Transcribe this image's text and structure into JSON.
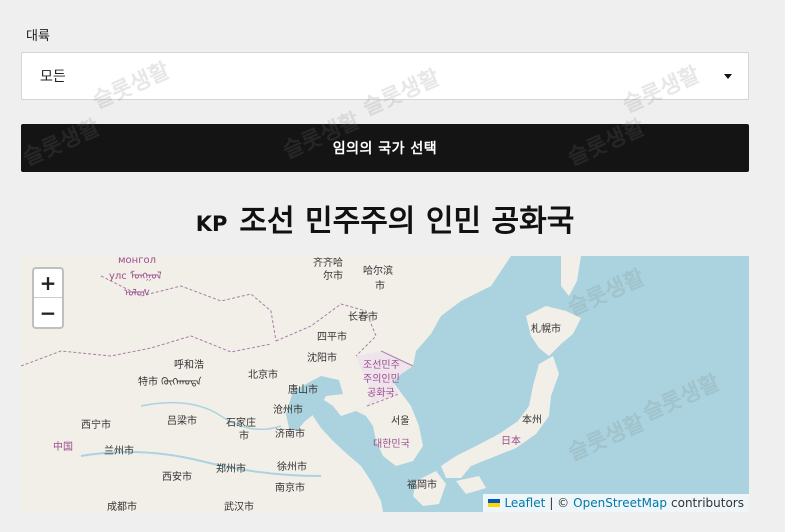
{
  "form": {
    "continent_label": "대륙",
    "continent_value": "모든",
    "random_button_label": "임의의 국가 선택"
  },
  "country": {
    "code": "KP",
    "name": "조선 민주주의 인민 공화국"
  },
  "map": {
    "zoom_in": "+",
    "zoom_out": "−",
    "attribution": {
      "leaflet": "Leaflet",
      "separator": "| ©",
      "osm": "OpenStreetMap",
      "contributors": "contributors"
    },
    "labels": {
      "mongolia_a": "монгол",
      "mongolia_b": "улс ᠮᠣᠩᠭᠣᠯ",
      "mongolia_c": "ᠤᠯᠤᠰ",
      "qiqihar_a": "齐齐哈",
      "qiqihar_b": "尔市",
      "harbin_a": "哈尔滨",
      "harbin_b": "市",
      "changchun": "长春市",
      "siping": "四平市",
      "shenyang": "沈阳市",
      "hohhot": "呼和浩",
      "tokyo_mongol": "特市 ᠬᠥᠬᠡᠬᠣᠲᠠ",
      "beijing": "北京市",
      "tangshan": "唐山市",
      "cangzhou": "沧州市",
      "shijiazhuang_a": "石家庄",
      "shijiazhuang_b": "市",
      "jinan": "济南市",
      "lvliang": "吕梁市",
      "xining": "西宁市",
      "lanzhou": "兰州市",
      "china": "中国",
      "zhengzhou": "郑州市",
      "xuzhou": "徐州市",
      "xian": "西安市",
      "nanjing": "南京市",
      "chengdu": "成都市",
      "wuhan": "武汉市",
      "kp_a": "조선민주",
      "kp_b": "주의인민",
      "kp_c": "공화국",
      "seoul": "서울",
      "kr": "대한민국",
      "sapporo": "札幌市",
      "honshu": "本州",
      "japan": "日本",
      "fukuoka": "福岡市"
    }
  },
  "watermark": "슬롯생활"
}
